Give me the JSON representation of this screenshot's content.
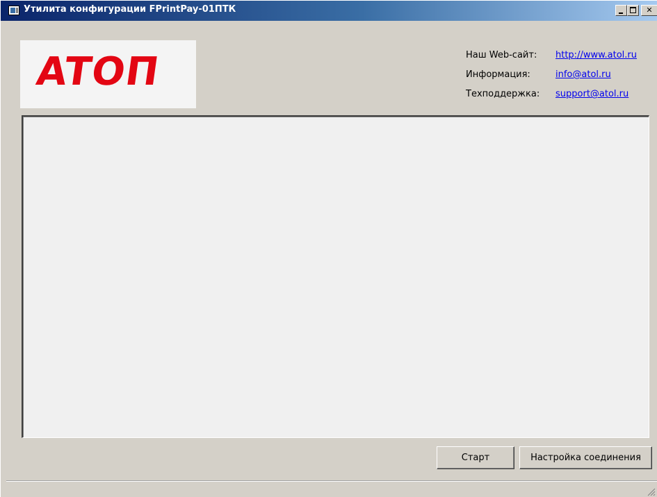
{
  "window": {
    "title": "Утилита конфигурации FPrintPay-01ПТК",
    "controls": {
      "minimize": "minimize",
      "maximize": "maximize",
      "close": "✕"
    }
  },
  "logo": {
    "text": "ATOΠ",
    "color": "#e30613"
  },
  "info": {
    "website_label": "Наш Web-сайт:",
    "website_link": "http://www.atol.ru",
    "info_label": "Информация:",
    "info_link": "info@atol.ru",
    "support_label": "Техподдержка:",
    "support_link": "support@atol.ru"
  },
  "buttons": {
    "start": "Старт",
    "connection_settings": "Настройка соединения"
  },
  "colors": {
    "titlebar_start": "#0a246a",
    "link": "#0000ee",
    "face": "#d4d0c8"
  }
}
